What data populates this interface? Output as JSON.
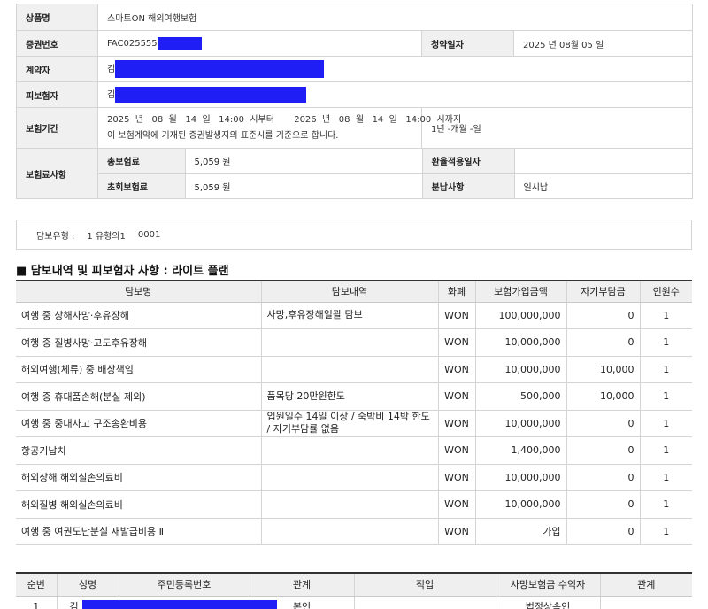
{
  "policy": {
    "product_label": "상품명",
    "product_value": "스마트ON 해외여행보험",
    "cert_label": "증권번호",
    "cert_value": "FAC025555",
    "subscribe_label": "청약일자",
    "subscribe_value": "2025 년 08월 05 일",
    "contractor_label": "계약자",
    "contractor_value": "김",
    "insured_label": "피보험자",
    "insured_value": "김",
    "period_label": "보험기간",
    "period_line1": "2025  년   08  월   14  일   14:00  시부터       2026  년   08  월   14  일   14:00  시까지",
    "period_line2": "이 보험계약에 기재된 증권발생지의 표준시를 기준으로 합니다.",
    "period_duration": "1년 -개월 -일",
    "premium_label": "보험료사항",
    "total_premium_label": "총보험료",
    "total_premium_value": "5,059 원",
    "refund_label": "환율적용일자",
    "refund_value": "",
    "first_premium_label": "초회보험료",
    "first_premium_value": "5,059 원",
    "installment_label": "분납사항",
    "installment_value": "일시납"
  },
  "coverage_type": {
    "label": "담보유형 :",
    "value": "1 유형의1",
    "code": "0001"
  },
  "section_title": "■ 담보내역 및 피보험자 사항 : 라이트 플랜",
  "coverage_table": {
    "headers": [
      "담보명",
      "담보내역",
      "화폐",
      "보험가입금액",
      "자기부담금",
      "인원수"
    ],
    "rows": [
      {
        "name": "여행 중 상해사망·후유장해",
        "detail": "사망,후유장해일괄 담보",
        "currency": "WON",
        "amount": "100,000,000",
        "deductible": "0",
        "count": "1"
      },
      {
        "name": "여행 중 질병사망·고도후유장해",
        "detail": "",
        "currency": "WON",
        "amount": "10,000,000",
        "deductible": "0",
        "count": "1"
      },
      {
        "name": "해외여행(체류) 중 배상책임",
        "detail": "",
        "currency": "WON",
        "amount": "10,000,000",
        "deductible": "10,000",
        "count": "1"
      },
      {
        "name": "여행 중 휴대품손해(분실 제외)",
        "detail": "품목당 20만원한도",
        "currency": "WON",
        "amount": "500,000",
        "deductible": "10,000",
        "count": "1"
      },
      {
        "name": "여행 중 중대사고 구조송환비용",
        "detail": "입원일수 14일 이상 / 숙박비 14박 한도 / 자기부담률 없음",
        "currency": "WON",
        "amount": "10,000,000",
        "deductible": "0",
        "count": "1"
      },
      {
        "name": "항공기납치",
        "detail": "",
        "currency": "WON",
        "amount": "1,400,000",
        "deductible": "0",
        "count": "1"
      },
      {
        "name": "해외상해 해외실손의료비",
        "detail": "",
        "currency": "WON",
        "amount": "10,000,000",
        "deductible": "0",
        "count": "1"
      },
      {
        "name": "해외질병 해외실손의료비",
        "detail": "",
        "currency": "WON",
        "amount": "10,000,000",
        "deductible": "0",
        "count": "1"
      },
      {
        "name": "여행 중 여권도난분실 재발급비용 Ⅱ",
        "detail": "",
        "currency": "WON",
        "amount": "가입",
        "deductible": "0",
        "count": "1"
      }
    ]
  },
  "insured_table": {
    "headers": [
      "순번",
      "성명",
      "주민등록번호",
      "관계",
      "직업",
      "사망보험금 수익자",
      "관계"
    ],
    "rows": [
      {
        "no": "1",
        "name": "김",
        "ssn": "",
        "relation": "본인",
        "job": "",
        "beneficiary": "법정상속인",
        "relation2": ""
      }
    ]
  },
  "colors": {
    "redaction": "#1e1ef5",
    "header_bg": "#f0f0f0",
    "border": "#d4d4d4"
  }
}
